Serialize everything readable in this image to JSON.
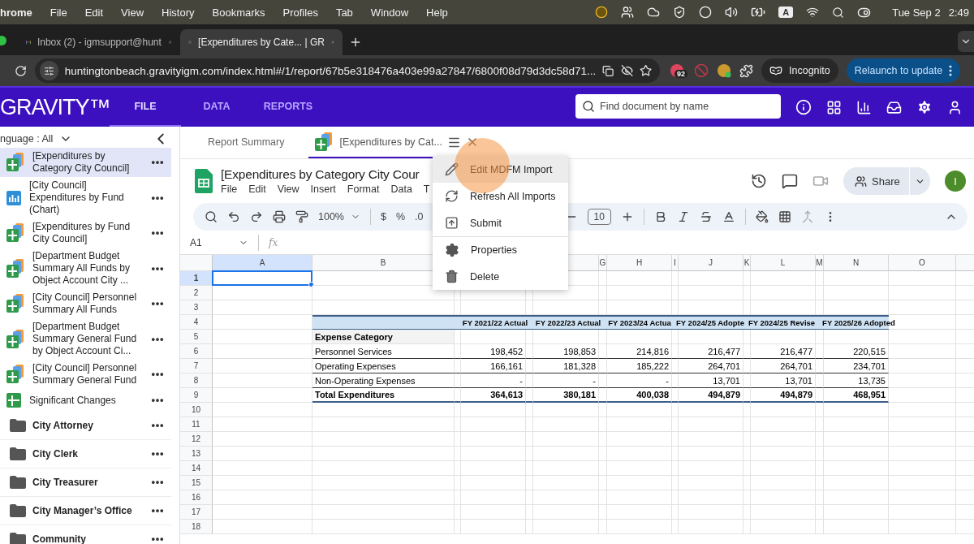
{
  "menubar": {
    "app": "hrome",
    "menus": [
      "File",
      "Edit",
      "View",
      "History",
      "Bookmarks",
      "Profiles",
      "Tab",
      "Window",
      "Help"
    ],
    "input_source": "A",
    "date": "Tue Sep 2",
    "time": "2:49"
  },
  "browser_tabs": [
    {
      "title": "Inbox (2) - igmsupport@hunt",
      "selected": false
    },
    {
      "title": "[Expenditures by Cate... | GR",
      "selected": true
    }
  ],
  "address_bar": {
    "url": "huntingtonbeach.gravityigm.com/index.html#/1/report/67b5e318476a403e99a27847/6800f08d79d3dc58d71...",
    "extension_badge": "92",
    "profile": "Incognito",
    "update_button": "Relaunch to update"
  },
  "app_header": {
    "logo": "GRAVITY™",
    "nav": [
      {
        "label": "FILE",
        "selected": true
      },
      {
        "label": "DATA",
        "selected": false
      },
      {
        "label": "REPORTS",
        "selected": false
      }
    ],
    "search": {
      "placeholder": "Find document by name"
    }
  },
  "sidebar": {
    "filter": "nguage : All",
    "items": [
      {
        "kind": "report",
        "label": "[Expenditures by Category City Council]",
        "selected": true
      },
      {
        "kind": "chart",
        "label": "[City Council] Expenditures by Fund (Chart)",
        "selected": false
      },
      {
        "kind": "report",
        "label": "[Expenditures by Fund City Council]",
        "selected": false
      },
      {
        "kind": "report",
        "label": "[Department Budget Summary All Funds by Object Account City ...",
        "selected": false
      },
      {
        "kind": "report",
        "label": "[City Council] Personnel Summary All Funds",
        "selected": false
      },
      {
        "kind": "report",
        "label": "[Department Budget Summary General Fund by Object Account Ci...",
        "selected": false
      },
      {
        "kind": "report",
        "label": "[City Council] Personnel Summary General Fund",
        "selected": false
      },
      {
        "kind": "sheet",
        "label": "Significant Changes",
        "selected": false
      },
      {
        "kind": "folder",
        "label": "City Attorney",
        "selected": false
      },
      {
        "kind": "folder",
        "label": "City Clerk",
        "selected": false
      },
      {
        "kind": "folder",
        "label": "City Treasurer",
        "selected": false
      },
      {
        "kind": "folder",
        "label": "City Manager’s Office",
        "selected": false
      },
      {
        "kind": "folder",
        "label": "Community",
        "selected": false
      }
    ]
  },
  "doc_tabs": [
    {
      "kind": "summary",
      "label": "Report Summary",
      "selected": false
    },
    {
      "kind": "report",
      "label": "[Expenditures by Cat...",
      "selected": true
    }
  ],
  "context_menu": {
    "items": [
      {
        "label": "Edit MDFM Import",
        "selected": true
      },
      {
        "label": "Refresh All Imports",
        "selected": false
      },
      {
        "label": "Submit",
        "selected": false
      },
      {
        "label": "Properties",
        "selected": false
      },
      {
        "label": "Delete",
        "selected": false
      }
    ]
  },
  "sheet": {
    "title": "[Expenditures by Category City Cour",
    "menus": [
      "File",
      "Edit",
      "View",
      "Insert",
      "Format",
      "Data",
      "T"
    ],
    "share": "Share",
    "avatar": "I",
    "toolbar": {
      "zoom": "100%",
      "currency": "$",
      "percent": "%",
      "decimal": ".0",
      "font_size": "10"
    },
    "name_box": "A1",
    "formula_label": "fx",
    "columns": [
      {
        "label": "A",
        "selected": true
      },
      {
        "label": "B",
        "selected": false
      },
      {
        "label": "G",
        "selected": false
      },
      {
        "label": "H",
        "selected": false
      },
      {
        "label": "I",
        "selected": false
      },
      {
        "label": "J",
        "selected": false
      },
      {
        "label": "K",
        "selected": false
      },
      {
        "label": "L",
        "selected": false
      },
      {
        "label": "M",
        "selected": false
      },
      {
        "label": "N",
        "selected": false
      },
      {
        "label": "O",
        "selected": false
      }
    ],
    "rows": [
      {
        "label": "1",
        "selected": true
      },
      {
        "label": "2",
        "selected": false
      },
      {
        "label": "3",
        "selected": false
      },
      {
        "label": "4",
        "selected": false
      },
      {
        "label": "5",
        "selected": false
      },
      {
        "label": "6",
        "selected": false
      },
      {
        "label": "7",
        "selected": false
      },
      {
        "label": "8",
        "selected": false
      },
      {
        "label": "9",
        "selected": false
      },
      {
        "label": "10",
        "selected": false
      },
      {
        "label": "11",
        "selected": false
      },
      {
        "label": "12",
        "selected": false
      },
      {
        "label": "13",
        "selected": false
      },
      {
        "label": "14",
        "selected": false
      },
      {
        "label": "15",
        "selected": false
      },
      {
        "label": "16",
        "selected": false
      },
      {
        "label": "17",
        "selected": false
      },
      {
        "label": "18",
        "selected": false
      }
    ],
    "table": {
      "headers": [
        "FY 2021/22 Actual",
        "FY 2022/23 Actual",
        "FY 2023/24 Actua",
        "FY 2024/25 Adopte",
        "FY 2024/25 Revise",
        "FY 2025/26 Adopted"
      ],
      "category_header": "Expense Category",
      "rows": [
        {
          "kind": "normal",
          "label": "Personnel Services",
          "values": [
            "198,452",
            "198,853",
            "214,816",
            "216,477",
            "216,477",
            "220,515"
          ]
        },
        {
          "kind": "normal",
          "label": "Operating Expenses",
          "values": [
            "166,161",
            "181,328",
            "185,222",
            "264,701",
            "264,701",
            "234,701"
          ]
        },
        {
          "kind": "normal",
          "label": "Non-Operating Expenses",
          "values": [
            "-",
            "-",
            "-",
            "13,701",
            "13,701",
            "13,735"
          ]
        },
        {
          "kind": "total",
          "label": "Total Expenditures",
          "values": [
            "364,613",
            "380,181",
            "400,038",
            "494,879",
            "494,879",
            "468,951"
          ]
        }
      ]
    }
  }
}
